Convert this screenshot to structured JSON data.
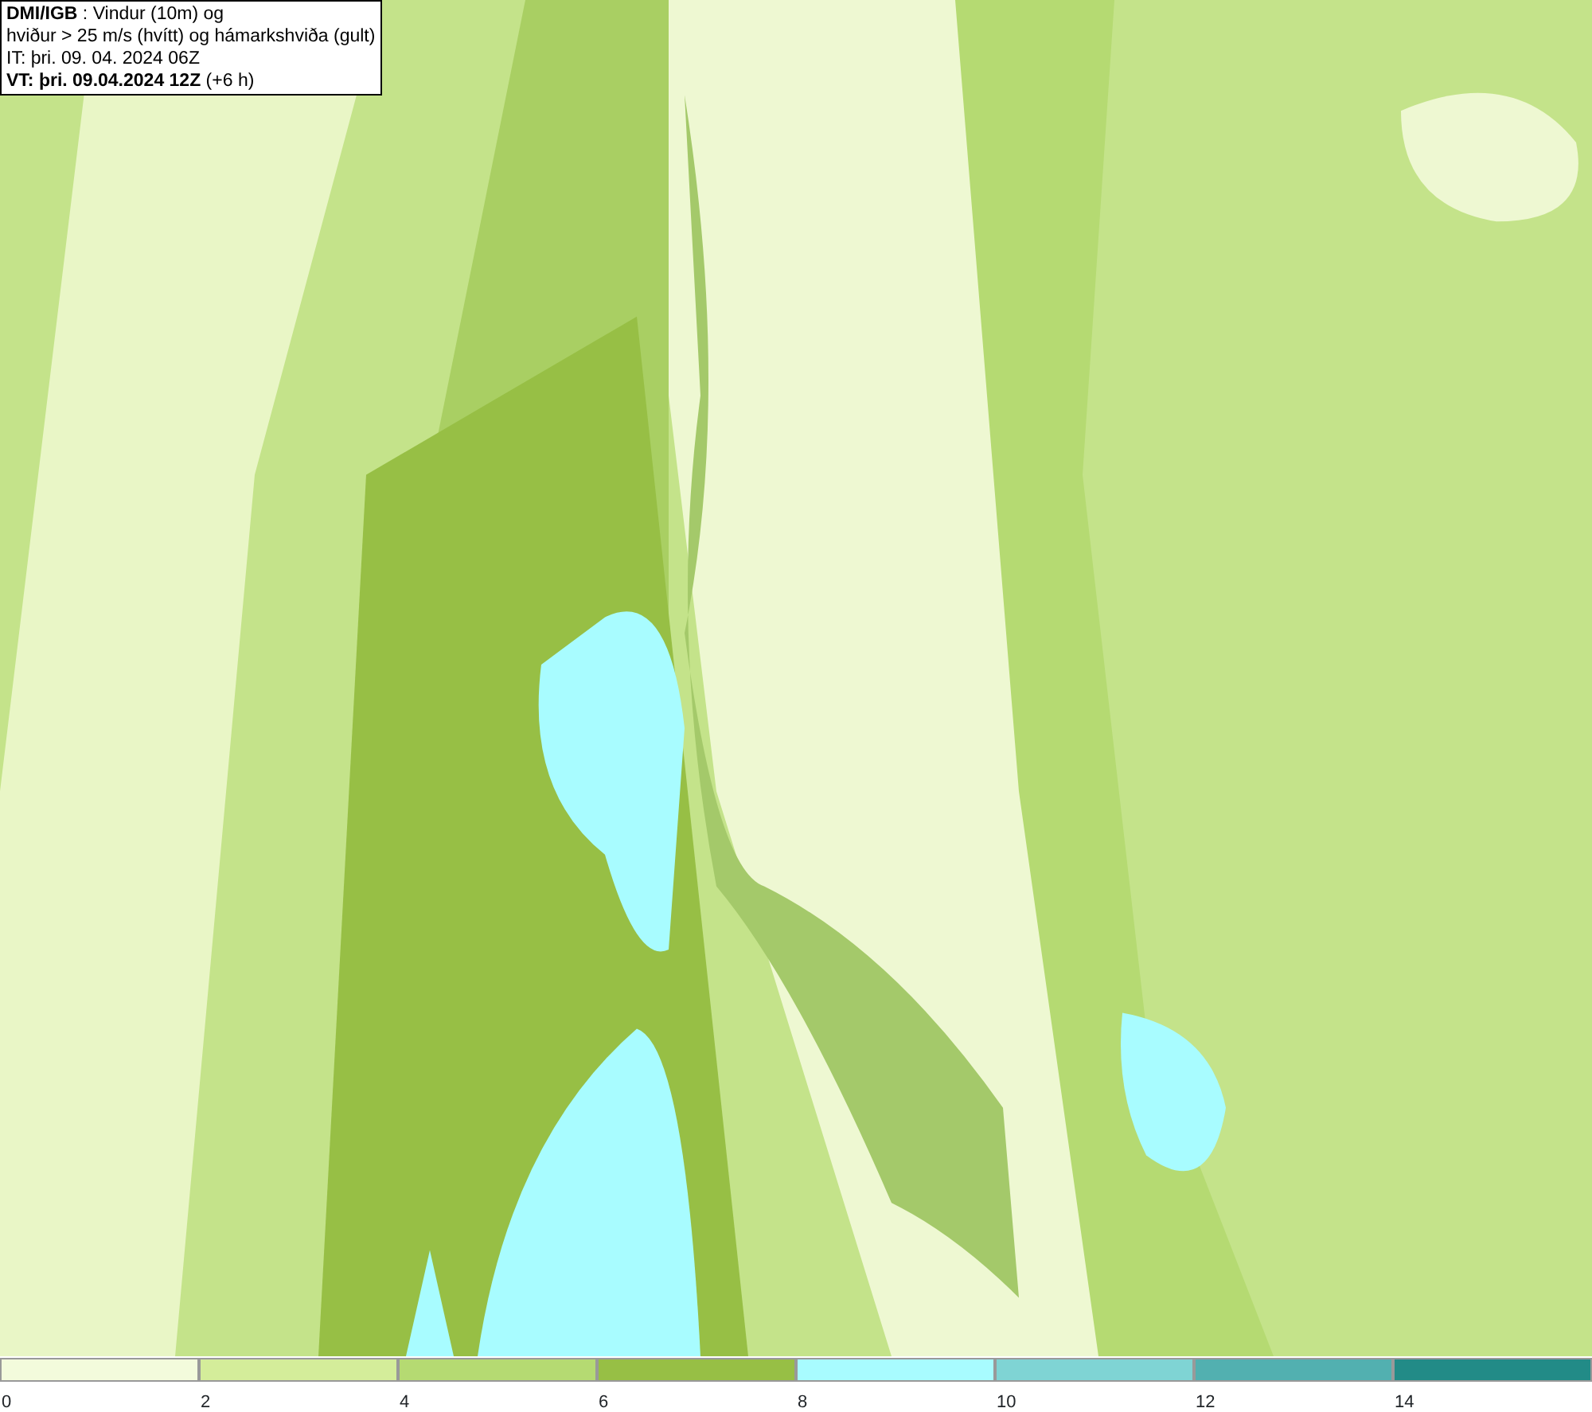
{
  "info_box": {
    "lines": [
      "**DMI/IGB** : Vindur (10m) og",
      "hviður > 25 m/s (hvítt) og hámarkshviða (gult)",
      "IT: þri. 09. 04. 2024 06Z",
      "**VT: þri. 09.04.2024 12Z** (+6 h)"
    ]
  },
  "legend": {
    "bins": [
      {
        "color": "#f3fbdc",
        "label": "0"
      },
      {
        "color": "#d4ed9a",
        "label": "2"
      },
      {
        "color": "#b5da72",
        "label": "4"
      },
      {
        "color": "#97bf45",
        "label": "6"
      },
      {
        "color": "#a8fcff",
        "label": "8"
      },
      {
        "color": "#7fd4d4",
        "label": "10"
      },
      {
        "color": "#52b0b0",
        "label": "12"
      },
      {
        "color": "#228b87",
        "label": "14"
      }
    ]
  }
}
